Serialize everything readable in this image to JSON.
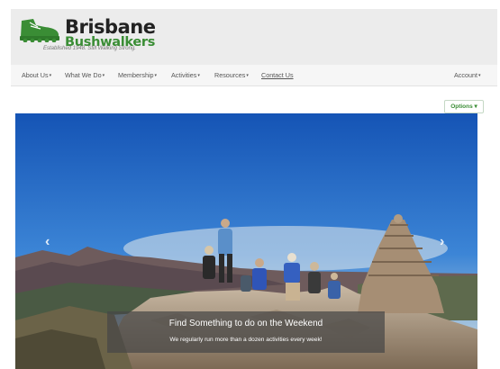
{
  "brand": {
    "line1": "Brisbane",
    "line2": "Bushwalkers",
    "tagline": "Established 1948. Still Walking Strong.",
    "logo_icon": "hiking-boot-icon",
    "green": "#3a8d35"
  },
  "nav": {
    "items": [
      {
        "label": "About Us",
        "dropdown": true
      },
      {
        "label": "What We Do",
        "dropdown": true
      },
      {
        "label": "Membership",
        "dropdown": true
      },
      {
        "label": "Activities",
        "dropdown": true
      },
      {
        "label": "Resources",
        "dropdown": true
      },
      {
        "label": "Contact Us",
        "dropdown": false
      }
    ],
    "account": "Account",
    "caret": "▾"
  },
  "options_label": "Options ▾",
  "carousel": {
    "title": "Find Something to do on the Weekend",
    "subtitle": "We regularly run more than a dozen activities every week!",
    "prev_icon": "chevron-left-icon",
    "next_icon": "chevron-right-icon",
    "prev_glyph": "‹",
    "next_glyph": "›",
    "slide_count": 3,
    "active_slide": 1
  }
}
